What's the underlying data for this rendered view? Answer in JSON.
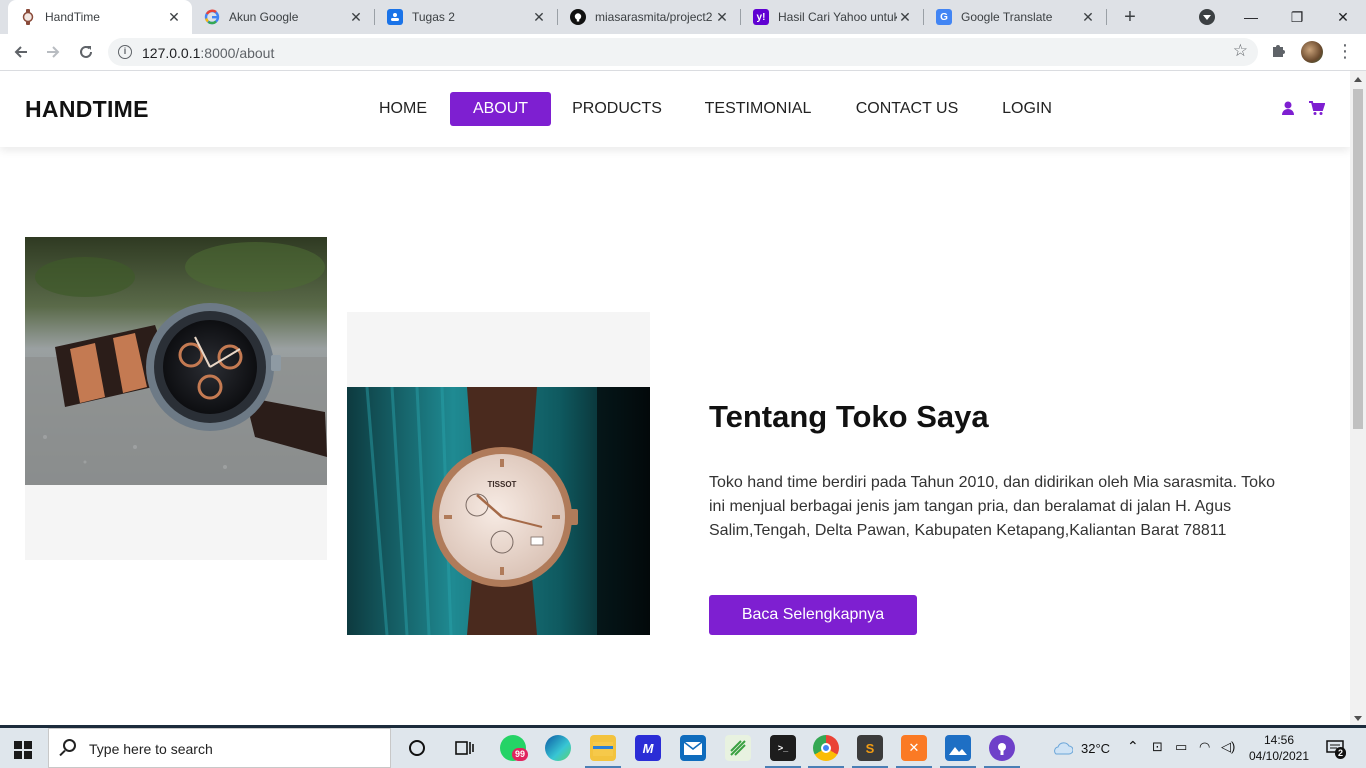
{
  "browser": {
    "tabs": [
      {
        "title": "HandTime",
        "active": true,
        "icon": "watch-favicon",
        "color": "#8a4b3a"
      },
      {
        "title": "Akun Google",
        "active": false,
        "icon": "google-g-icon",
        "color": "#4285f4"
      },
      {
        "title": "Tugas 2",
        "active": false,
        "icon": "classroom-icon",
        "color": "#1a73e8"
      },
      {
        "title": "miasarasmita/project2",
        "active": false,
        "icon": "github-icon",
        "color": "#111111"
      },
      {
        "title": "Hasil Cari Yahoo untuk",
        "active": false,
        "icon": "yahoo-icon",
        "color": "#6001d2"
      },
      {
        "title": "Google Translate",
        "active": false,
        "icon": "translate-icon",
        "color": "#4285f4"
      }
    ],
    "close_glyph": "✕",
    "new_tab_glyph": "+",
    "window_controls": {
      "minimize": "—",
      "restore": "❐",
      "close": "✕"
    },
    "url_host": "127.0.0.1",
    "url_path": ":8000/about"
  },
  "site": {
    "brand": "HANDTIME",
    "nav": [
      {
        "label": "HOME",
        "active": false
      },
      {
        "label": "ABOUT",
        "active": true
      },
      {
        "label": "PRODUCTS",
        "active": false
      },
      {
        "label": "TESTIMONIAL",
        "active": false
      },
      {
        "label": "CONTACT US",
        "active": false
      },
      {
        "label": "LOGIN",
        "active": false
      }
    ],
    "accent_color": "#7e1fd1",
    "about": {
      "title": "Tentang Toko Saya",
      "description": "Toko hand time berdiri pada Tahun 2010, dan didirikan oleh Mia sarasmita. Toko ini menjual berbagai jenis jam tangan pria, dan beralamat di jalan H. Agus Salim,Tengah, Delta Pawan, Kabupaten Ketapang,Kaliantan Barat 78811",
      "cta_label": "Baca Selengkapnya",
      "watch_brand_text": "TISSOT"
    }
  },
  "taskbar": {
    "search_placeholder": "Type here to search",
    "whatsapp_badge": "99",
    "temperature": "32°C",
    "time": "14:56",
    "date": "04/10/2021",
    "notification_count": "2"
  }
}
